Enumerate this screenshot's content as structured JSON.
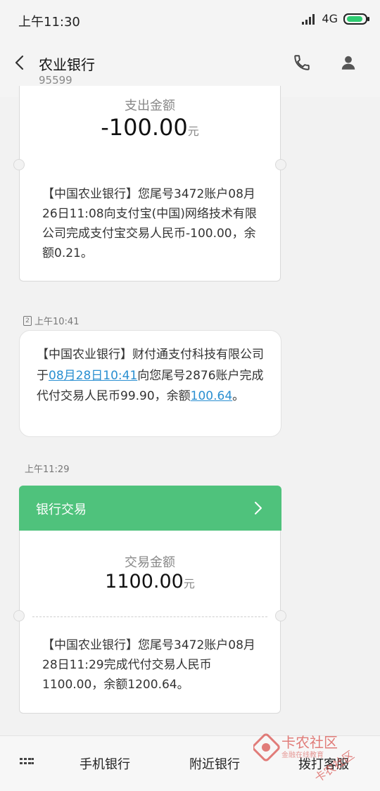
{
  "status_bar": {
    "time": "上午11:30",
    "network": "4G"
  },
  "header": {
    "contact_name": "农业银行",
    "contact_number": "95599",
    "icons": [
      "back-icon",
      "phone-icon",
      "person-icon"
    ]
  },
  "messages": [
    {
      "type": "card",
      "amount_label": "支出金额",
      "amount": "-100.00",
      "unit": "元",
      "text": "【中国农业银行】您尾号3472账户08月26日11:08向支付宝(中国)网络技术有限公司完成支付宝交易人民币-100.00，余额0.21。"
    },
    {
      "type": "bubble",
      "sim": "2",
      "time": "上午10:41",
      "text_parts": [
        "【中国农业银行】财付通支付科技有限公司于",
        "08月28日10:41",
        "向您尾号2876账户完成代付交易人民币99.90，余额",
        "100.64",
        "。"
      ]
    },
    {
      "type": "card",
      "time": "上午11:29",
      "header_label": "银行交易",
      "amount_label": "交易金额",
      "amount": "1100.00",
      "unit": "元",
      "text": "【中国农业银行】您尾号3472账户08月28日11:29完成代付交易人民币1100.00，余额1200.64。"
    }
  ],
  "bottom_bar": {
    "items": [
      "手机银行",
      "附近银行",
      "拨打客服"
    ]
  },
  "watermark": {
    "title": "卡农社区",
    "subtitle": "金融在线教育",
    "corner": "卡农社区"
  },
  "colors": {
    "accent_green": "#4fc27c",
    "link_blue": "#2a8fd1"
  }
}
